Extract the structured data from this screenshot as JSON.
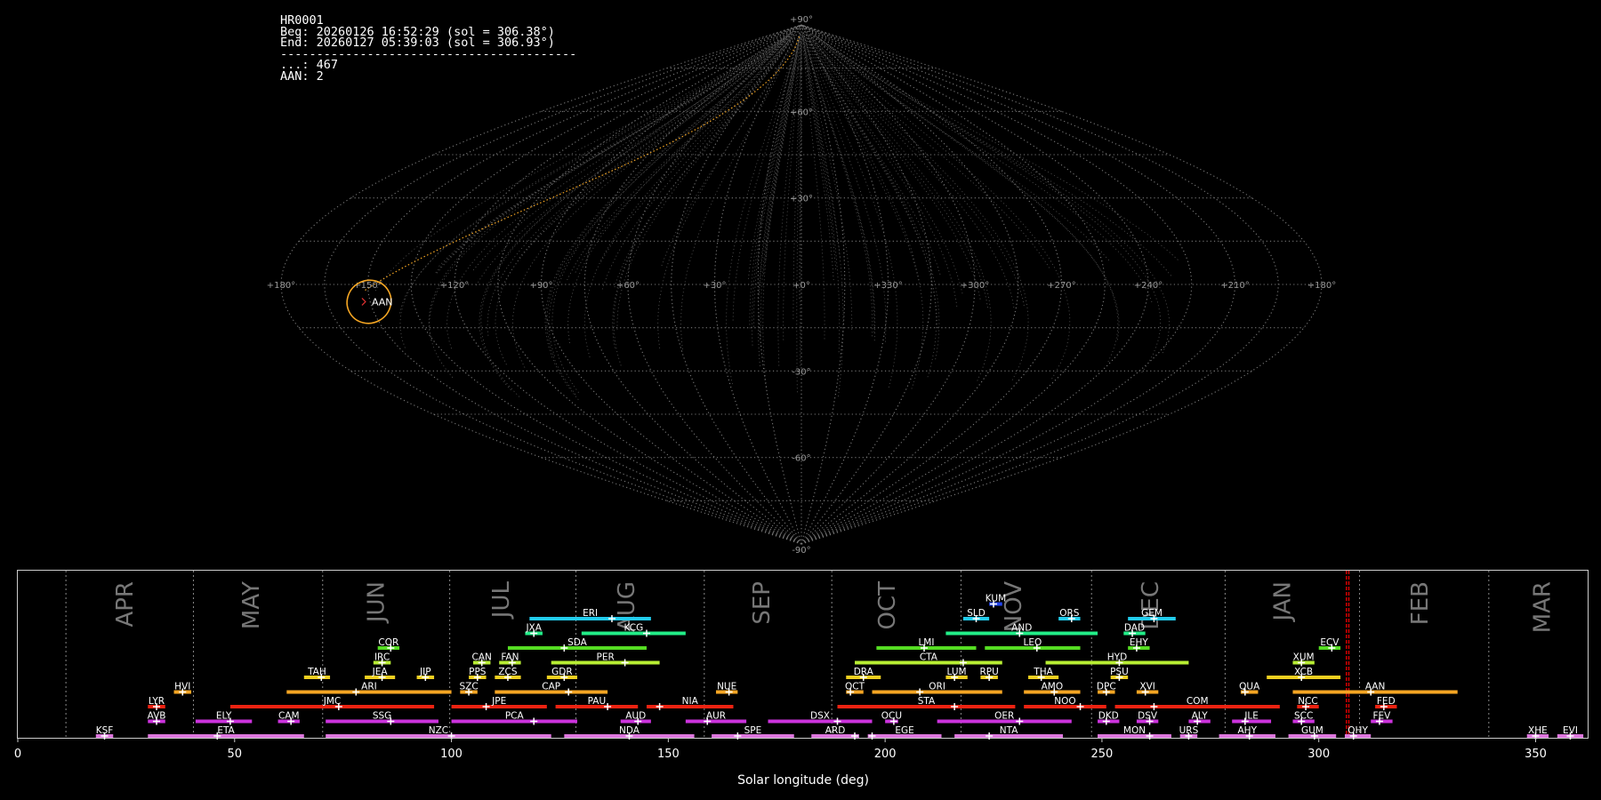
{
  "info": {
    "lines": [
      "HR0001",
      "Beg: 20260126 16:52:29 (sol = 306.38°)",
      "End: 20260127 05:39:03 (sol = 306.93°)",
      "-----------------------------------------",
      "...: 467",
      "AAN: 2"
    ]
  },
  "colors": {
    "highlight": "#f5a623",
    "grid": "#777777",
    "current_sol_line": "#e00000"
  },
  "chart_data": [
    {
      "type": "sky map",
      "projection": "sinusoidal",
      "longitude_labels": [
        "+180°",
        "+150°",
        "+120°",
        "+90°",
        "+60°",
        "+30°",
        "+0°",
        "+330°",
        "+300°",
        "+270°",
        "+240°",
        "+210°",
        "+180°"
      ],
      "latitude_labels": [
        "+90°",
        "+60°",
        "+30°",
        "-30°",
        "-60°",
        "-90°"
      ],
      "highlighted_shower": {
        "code": "AAN",
        "lon": 151,
        "lat": -6
      }
    },
    {
      "type": "bar",
      "orientation": "horizontal",
      "xlabel": "Solar longitude (deg)",
      "xlim": [
        0,
        362
      ],
      "xticks": [
        0,
        50,
        100,
        150,
        200,
        250,
        300,
        350
      ],
      "current_sol": [
        306.38,
        306.93
      ],
      "months": [
        {
          "label": "APR",
          "start": 11.1,
          "center": 24.6
        },
        {
          "label": "MAY",
          "start": 40.5,
          "center": 53.7
        },
        {
          "label": "JUN",
          "start": 70.3,
          "center": 82.6
        },
        {
          "label": "JUL",
          "start": 99.6,
          "center": 111.4
        },
        {
          "label": "AUG",
          "start": 128.7,
          "center": 140.3
        },
        {
          "label": "SEP",
          "start": 158.3,
          "center": 171.5
        },
        {
          "label": "OCT",
          "start": 187.7,
          "center": 200.4
        },
        {
          "label": "NOV",
          "start": 217.5,
          "center": 229.5
        },
        {
          "label": "DEC",
          "start": 247.6,
          "center": 261.1
        },
        {
          "label": "JAN",
          "start": 278.4,
          "center": 291.5
        },
        {
          "label": "FEB",
          "start": 309.4,
          "center": 323.2
        },
        {
          "label": "MAR",
          "start": 339.2,
          "center": 351.4
        }
      ],
      "showers": [
        {
          "code": "KSF",
          "start": 18,
          "end": 22,
          "peak": 20,
          "row": 0
        },
        {
          "code": "ETA",
          "start": 30,
          "end": 66,
          "peak": 46,
          "row": 0
        },
        {
          "code": "NZC",
          "start": 71,
          "end": 123,
          "peak": 100,
          "row": 0
        },
        {
          "code": "NDA",
          "start": 126,
          "end": 156,
          "peak": 141,
          "row": 0
        },
        {
          "code": "SPE",
          "start": 160,
          "end": 179,
          "peak": 166,
          "row": 0
        },
        {
          "code": "ARD",
          "start": 183,
          "end": 194,
          "peak": 193,
          "row": 0
        },
        {
          "code": "EGE",
          "start": 196,
          "end": 213,
          "peak": 197,
          "row": 0
        },
        {
          "code": "NTA",
          "start": 216,
          "end": 241,
          "peak": 224,
          "row": 0
        },
        {
          "code": "MON",
          "start": 249,
          "end": 266,
          "peak": 261,
          "row": 0
        },
        {
          "code": "URS",
          "start": 268,
          "end": 272,
          "peak": 270,
          "row": 0
        },
        {
          "code": "AHY",
          "start": 277,
          "end": 290,
          "peak": 284,
          "row": 0
        },
        {
          "code": "GUM",
          "start": 293,
          "end": 304,
          "peak": 299,
          "row": 0
        },
        {
          "code": "OHY",
          "start": 306,
          "end": 312,
          "peak": 308,
          "row": 0
        },
        {
          "code": "XHE",
          "start": 348,
          "end": 353,
          "peak": 350,
          "row": 0
        },
        {
          "code": "EVI",
          "start": 355,
          "end": 361,
          "peak": 358,
          "row": 0
        },
        {
          "code": "AVB",
          "start": 30,
          "end": 34,
          "peak": 32,
          "row": 1
        },
        {
          "code": "ELY",
          "start": 41,
          "end": 54,
          "peak": 49,
          "row": 1
        },
        {
          "code": "CAM",
          "start": 60,
          "end": 65,
          "peak": 63,
          "row": 1
        },
        {
          "code": "SSG",
          "start": 71,
          "end": 97,
          "peak": 86,
          "row": 1
        },
        {
          "code": "PCA",
          "start": 100,
          "end": 129,
          "peak": 119,
          "row": 1
        },
        {
          "code": "AUD",
          "start": 139,
          "end": 146,
          "peak": 143,
          "row": 1
        },
        {
          "code": "AUR",
          "start": 154,
          "end": 168,
          "peak": 159,
          "row": 1
        },
        {
          "code": "DSX",
          "start": 173,
          "end": 197,
          "peak": 189,
          "row": 1
        },
        {
          "code": "OCU",
          "start": 200,
          "end": 203,
          "peak": 202,
          "row": 1
        },
        {
          "code": "OER",
          "start": 212,
          "end": 243,
          "peak": 231,
          "row": 1
        },
        {
          "code": "DKD",
          "start": 249,
          "end": 254,
          "peak": 251,
          "row": 1
        },
        {
          "code": "DSV",
          "start": 258,
          "end": 263,
          "peak": 261,
          "row": 1
        },
        {
          "code": "ALY",
          "start": 270,
          "end": 275,
          "peak": 272,
          "row": 1
        },
        {
          "code": "JLE",
          "start": 280,
          "end": 289,
          "peak": 283,
          "row": 1
        },
        {
          "code": "SCC",
          "start": 294,
          "end": 299,
          "peak": 296,
          "row": 1
        },
        {
          "code": "FEV",
          "start": 312,
          "end": 317,
          "peak": 314,
          "row": 1
        },
        {
          "code": "LYR",
          "start": 30,
          "end": 34,
          "peak": 32,
          "row": 2
        },
        {
          "code": "JMC",
          "start": 49,
          "end": 96,
          "peak": 74,
          "row": 2
        },
        {
          "code": "JPE",
          "start": 100,
          "end": 122,
          "peak": 108,
          "row": 2
        },
        {
          "code": "PAU",
          "start": 124,
          "end": 143,
          "peak": 136,
          "row": 2
        },
        {
          "code": "NIA",
          "start": 145,
          "end": 165,
          "peak": 148,
          "row": 2
        },
        {
          "code": "STA",
          "start": 189,
          "end": 230,
          "peak": 216,
          "row": 2
        },
        {
          "code": "NOO",
          "start": 232,
          "end": 251,
          "peak": 245,
          "row": 2
        },
        {
          "code": "COM",
          "start": 253,
          "end": 291,
          "peak": 262,
          "row": 2
        },
        {
          "code": "NCC",
          "start": 295,
          "end": 300,
          "peak": 297,
          "row": 2
        },
        {
          "code": "FED",
          "start": 313,
          "end": 318,
          "peak": 315,
          "row": 2
        },
        {
          "code": "HVI",
          "start": 36,
          "end": 40,
          "peak": 38,
          "row": 3
        },
        {
          "code": "ARI",
          "start": 62,
          "end": 100,
          "peak": 78,
          "row": 3
        },
        {
          "code": "SZC",
          "start": 102,
          "end": 106,
          "peak": 104,
          "row": 3
        },
        {
          "code": "CAP",
          "start": 110,
          "end": 136,
          "peak": 127,
          "row": 3
        },
        {
          "code": "NUE",
          "start": 161,
          "end": 166,
          "peak": 164,
          "row": 3
        },
        {
          "code": "OCT",
          "start": 191,
          "end": 195,
          "peak": 192,
          "row": 3
        },
        {
          "code": "ORI",
          "start": 197,
          "end": 227,
          "peak": 208,
          "row": 3
        },
        {
          "code": "AMO",
          "start": 232,
          "end": 245,
          "peak": 239,
          "row": 3
        },
        {
          "code": "DPC",
          "start": 249,
          "end": 253,
          "peak": 251,
          "row": 3
        },
        {
          "code": "XVI",
          "start": 258,
          "end": 263,
          "peak": 260,
          "row": 3
        },
        {
          "code": "QUA",
          "start": 282,
          "end": 286,
          "peak": 283,
          "row": 3
        },
        {
          "code": "AAN",
          "start": 294,
          "end": 332,
          "peak": 312,
          "row": 3,
          "highlight": true
        },
        {
          "code": "TAH",
          "start": 66,
          "end": 72,
          "peak": 70,
          "row": 4
        },
        {
          "code": "JEA",
          "start": 80,
          "end": 87,
          "peak": 84,
          "row": 4
        },
        {
          "code": "JIP",
          "start": 92,
          "end": 96,
          "peak": 94,
          "row": 4
        },
        {
          "code": "PPS",
          "start": 104,
          "end": 108,
          "peak": 106,
          "row": 4
        },
        {
          "code": "ZCS",
          "start": 110,
          "end": 116,
          "peak": 113,
          "row": 4
        },
        {
          "code": "GDR",
          "start": 122,
          "end": 129,
          "peak": 126,
          "row": 4
        },
        {
          "code": "DRA",
          "start": 191,
          "end": 199,
          "peak": 195,
          "row": 4
        },
        {
          "code": "LUM",
          "start": 214,
          "end": 219,
          "peak": 216,
          "row": 4
        },
        {
          "code": "RPU",
          "start": 222,
          "end": 226,
          "peak": 224,
          "row": 4
        },
        {
          "code": "THA",
          "start": 233,
          "end": 240,
          "peak": 236,
          "row": 4
        },
        {
          "code": "PSU",
          "start": 252,
          "end": 256,
          "peak": 254,
          "row": 4
        },
        {
          "code": "XCB",
          "start": 288,
          "end": 305,
          "peak": 296,
          "row": 4
        },
        {
          "code": "IRC",
          "start": 82,
          "end": 86,
          "peak": 84,
          "row": 5
        },
        {
          "code": "CAN",
          "start": 105,
          "end": 109,
          "peak": 107,
          "row": 5
        },
        {
          "code": "FAN",
          "start": 111,
          "end": 116,
          "peak": 114,
          "row": 5
        },
        {
          "code": "PER",
          "start": 123,
          "end": 148,
          "peak": 140,
          "row": 5
        },
        {
          "code": "CTA",
          "start": 193,
          "end": 227,
          "peak": 218,
          "row": 5
        },
        {
          "code": "HYD",
          "start": 237,
          "end": 270,
          "peak": 254,
          "row": 5
        },
        {
          "code": "XUM",
          "start": 294,
          "end": 299,
          "peak": 296,
          "row": 5
        },
        {
          "code": "COR",
          "start": 83,
          "end": 88,
          "peak": 86,
          "row": 6
        },
        {
          "code": "SDA",
          "start": 113,
          "end": 145,
          "peak": 126,
          "row": 6
        },
        {
          "code": "LMI",
          "start": 198,
          "end": 221,
          "peak": 209,
          "row": 6
        },
        {
          "code": "LEO",
          "start": 223,
          "end": 245,
          "peak": 235,
          "row": 6
        },
        {
          "code": "EHY",
          "start": 256,
          "end": 261,
          "peak": 258,
          "row": 6
        },
        {
          "code": "ECV",
          "start": 300,
          "end": 305,
          "peak": 303,
          "row": 6
        },
        {
          "code": "JXA",
          "start": 117,
          "end": 121,
          "peak": 119,
          "row": 7
        },
        {
          "code": "KCG",
          "start": 130,
          "end": 154,
          "peak": 145,
          "row": 7
        },
        {
          "code": "AND",
          "start": 214,
          "end": 249,
          "peak": 231,
          "row": 7
        },
        {
          "code": "DAD",
          "start": 255,
          "end": 260,
          "peak": 257,
          "row": 7
        },
        {
          "code": "ERI",
          "start": 118,
          "end": 146,
          "peak": 137,
          "row": 8
        },
        {
          "code": "SLD",
          "start": 218,
          "end": 224,
          "peak": 221,
          "row": 8
        },
        {
          "code": "ORS",
          "start": 240,
          "end": 245,
          "peak": 243,
          "row": 8
        },
        {
          "code": "GEM",
          "start": 256,
          "end": 267,
          "peak": 262,
          "row": 8
        },
        {
          "code": "KUM",
          "start": 224,
          "end": 227,
          "peak": 225,
          "row": 9
        }
      ]
    }
  ]
}
